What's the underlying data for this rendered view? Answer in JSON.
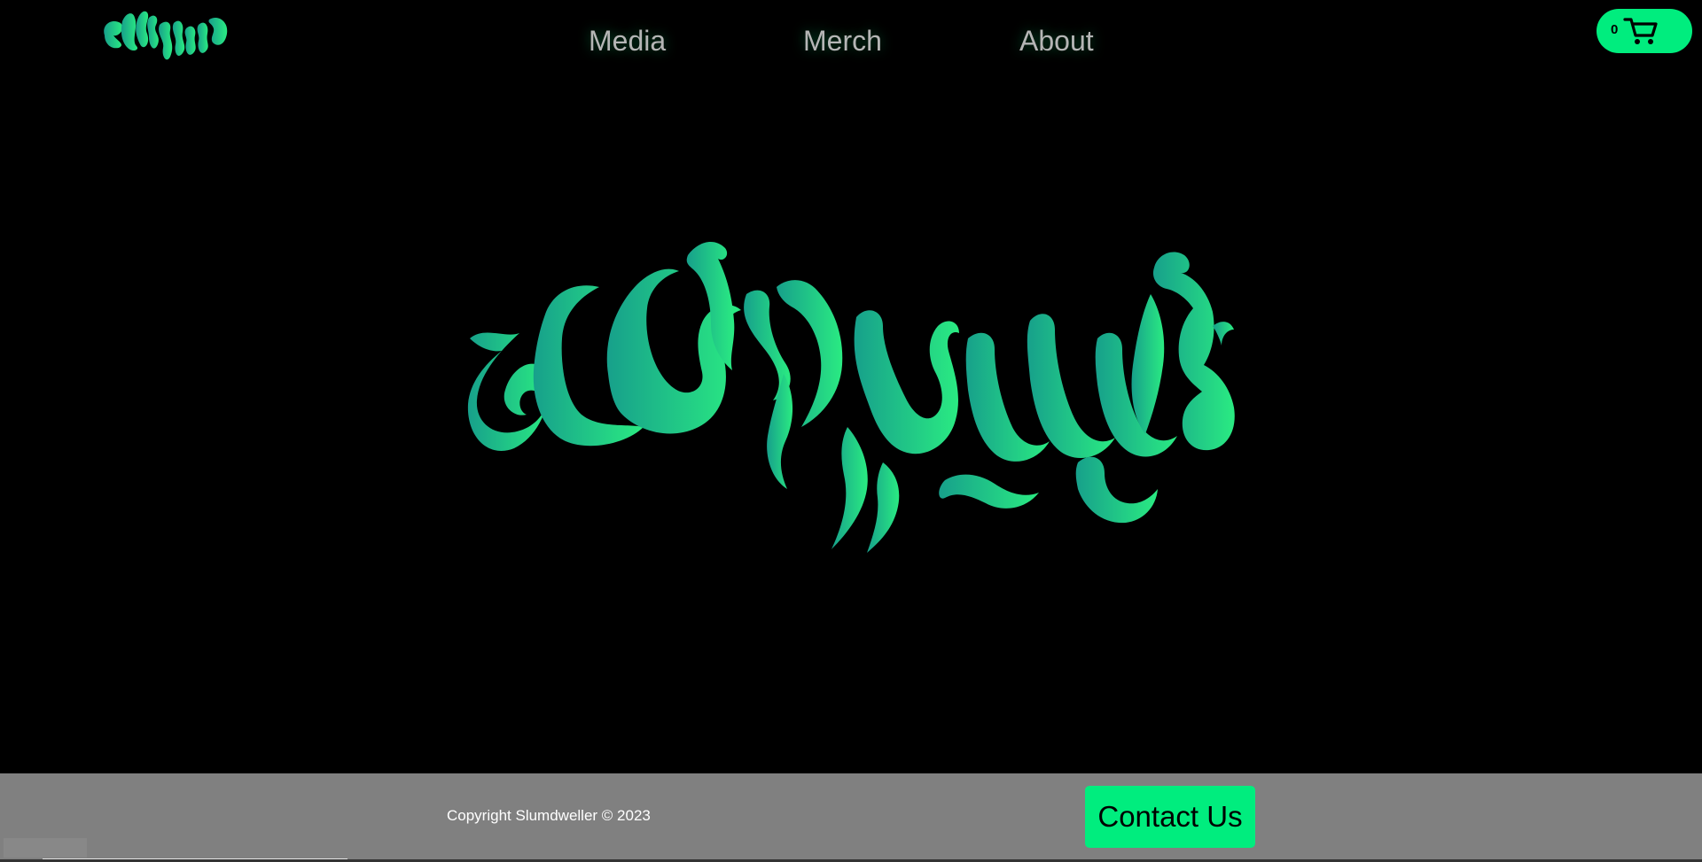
{
  "brand": {
    "name": "Slumdweller",
    "accent_color": "#00ed7e",
    "gradient_start": "#17a08b",
    "gradient_end": "#2aeb82"
  },
  "nav": {
    "items": [
      {
        "label": "Media"
      },
      {
        "label": "Merch"
      },
      {
        "label": "About"
      }
    ]
  },
  "cart": {
    "count": "0",
    "icon": "shopping-cart-icon"
  },
  "footer": {
    "copyright": "Copyright Slumdweller © 2023",
    "contact_label": "Contact Us",
    "background": "#808080"
  }
}
